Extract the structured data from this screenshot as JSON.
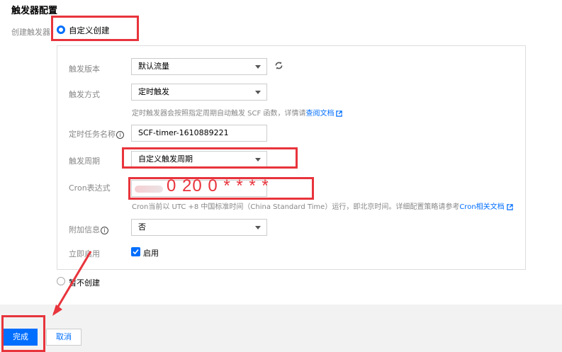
{
  "section": {
    "title": "触发器配置"
  },
  "create_trigger": {
    "label": "创建触发器",
    "option_custom": "自定义创建",
    "option_none": "暂不创建"
  },
  "form": {
    "version": {
      "label": "触发版本",
      "value": "默认流量"
    },
    "method": {
      "label": "触发方式",
      "value": "定时触发",
      "help_prefix": "定时触发器会按照指定周期自动触发 SCF 函数，详情请",
      "help_link": "查阅文档"
    },
    "task_name": {
      "label": "定时任务名称",
      "value": "SCF-timer-1610889221"
    },
    "period": {
      "label": "触发周期",
      "value": "自定义触发周期"
    },
    "cron": {
      "label": "Cron表达式",
      "value": "0 20 0 * * * *",
      "help_prefix": "Cron当前以 UTC +8 中国标准时间（China Standard Time）运行，即北京时间。详细配置策略请参考",
      "help_link": "Cron相关文档"
    },
    "extra": {
      "label": "附加信息",
      "value": "否"
    },
    "enable": {
      "label": "立即启用",
      "checkbox_label": "启用",
      "checked": true
    }
  },
  "footer": {
    "confirm": "完成",
    "cancel": "取消"
  },
  "colors": {
    "primary": "#006eff",
    "annotation": "#e8343c"
  },
  "icons": [
    "refresh-icon",
    "info-icon",
    "external-link-icon",
    "caret-down-icon",
    "check-icon"
  ]
}
